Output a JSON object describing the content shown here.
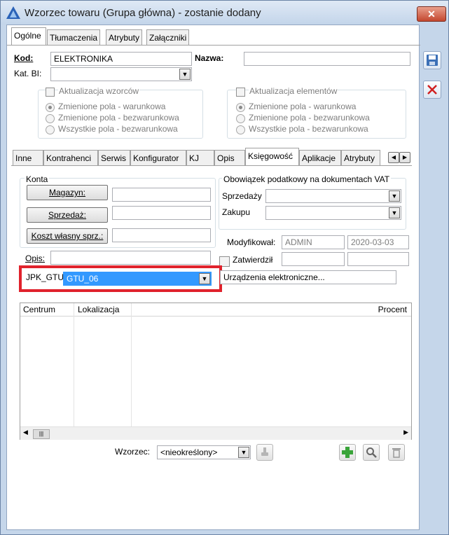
{
  "window": {
    "title": "Wzorzec towaru (Grupa główna) - zostanie dodany",
    "close_label": "✕"
  },
  "top_tabs": [
    "Ogólne",
    "Tłumaczenia",
    "Atrybuty",
    "Załączniki"
  ],
  "header": {
    "kod_label": "Kod:",
    "kod_value": "ELEKTRONIKA",
    "nazwa_label": "Nazwa:",
    "nazwa_value": "",
    "katbi_label": "Kat. BI:",
    "katbi_value": ""
  },
  "wzorcow_group": {
    "checkbox_label": "Aktualizacja wzorców",
    "options": [
      "Zmienione pola - warunkowa",
      "Zmienione pola - bezwarunkowa",
      "Wszystkie pola - bezwarunkowa"
    ]
  },
  "elementow_group": {
    "checkbox_label": "Aktualizacja elementów",
    "options": [
      "Zmienione pola - warunkowa",
      "Zmienione pola - bezwarunkowa",
      "Wszystkie pola - bezwarunkowa"
    ]
  },
  "inner_tabs": [
    "Inne",
    "Kontrahenci",
    "Serwis",
    "Konfigurator",
    "KJ",
    "Opis",
    "Księgowość",
    "Aplikacje",
    "Atrybuty"
  ],
  "konta": {
    "title": "Konta",
    "magazyn": "Magazyn:",
    "sprzedaz": "Sprzedaż:",
    "koszt": "Koszt własny sprz.:"
  },
  "vat": {
    "title": "Obowiązek podatkowy na dokumentach VAT",
    "sprzedazy": "Sprzedaży",
    "zakupu": "Zakupu"
  },
  "modyfikowal": {
    "label": "Modyfikował:",
    "user": "ADMIN",
    "date": "2020-03-03"
  },
  "zatwierdzil": {
    "label": "Zatwierdził"
  },
  "opis": {
    "label": "Opis:",
    "value": ""
  },
  "jpk": {
    "label": "JPK_GTU:",
    "value": "GTU_06",
    "description": "Urządzenia elektroniczne..."
  },
  "table": {
    "columns": [
      "Centrum",
      "Lokalizacja",
      "Procent"
    ],
    "rows": []
  },
  "footer": {
    "wzorzec_label": "Wzorzec:",
    "wzorzec_value": "<nieokreślony>"
  },
  "colors": {
    "selection": "#3399ff",
    "highlight_border": "#e0222c",
    "accent_add": "#3aa43a"
  }
}
